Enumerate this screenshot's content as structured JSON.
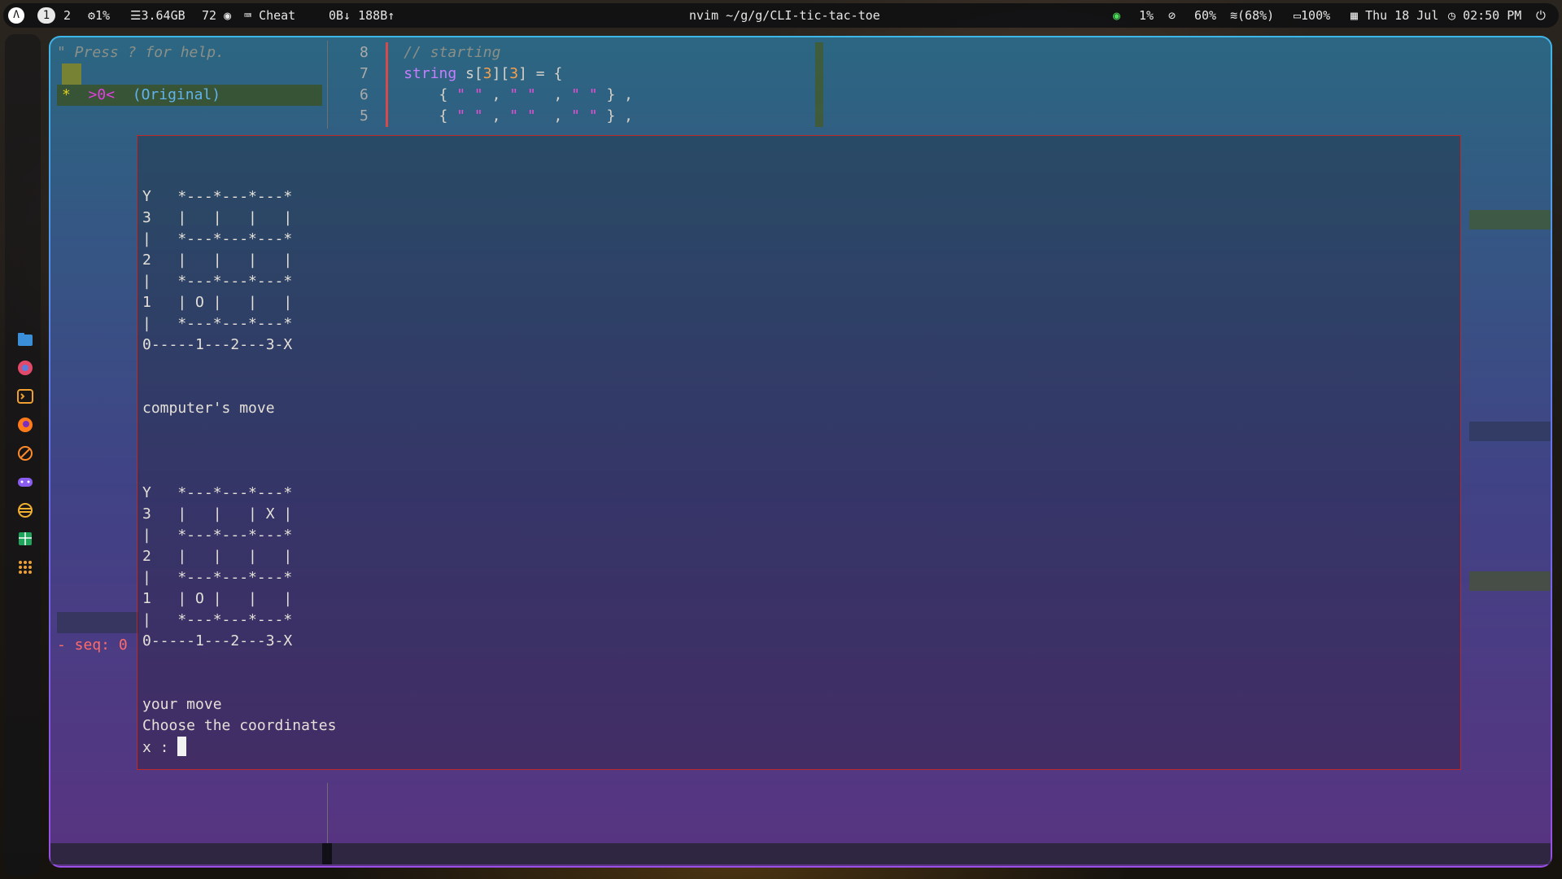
{
  "topbar": {
    "launcher_icon": "arch-logo-icon",
    "workspaces": [
      "1",
      "2"
    ],
    "active_workspace": "1",
    "cpu": "1%",
    "memory": "3.64GB",
    "temp": "72",
    "keyboard_app": "Cheat",
    "network_traffic": "0B↓ 188B↑",
    "window_title": "nvim ~/g/g/CLI-tic-tac-toe",
    "wifi_signal": "1%",
    "privacy_value": "60%",
    "wifi_strength": "(68%)",
    "battery": "100%",
    "date": "Thu 18 Jul",
    "time": "02:50 PM"
  },
  "dock": {
    "icons": [
      "file-manager-icon",
      "browser-icon",
      "terminal-icon",
      "firefox-icon",
      "tools-icon",
      "game-controller-icon",
      "settings-icon",
      "spreadsheet-icon",
      "app-grid-icon"
    ]
  },
  "nvim": {
    "help_hint": "\" Press ? for help.",
    "undotree_star": "*",
    "undotree_marker": ">0<",
    "undotree_label": "(Original)",
    "seq_label": "- seq: 0",
    "code_lines": [
      {
        "num": "8",
        "comment": "// starting"
      },
      {
        "num": "7",
        "kw": "string",
        "text": " s[",
        "n1": "3",
        "mid": "][",
        "n2": "3",
        "end": "] = {"
      },
      {
        "num": "6",
        "open": "    { ",
        "s1": "\" \"",
        "c1": " , ",
        "s2": "\" \"",
        "c2": "  , ",
        "s3": "\" \"",
        "close": " } ,"
      },
      {
        "num": "5",
        "open": "    { ",
        "s1": "\" \"",
        "c1": " , ",
        "s2": "\" \"",
        "c2": "  , ",
        "s3": "\" \"",
        "close": " } ,"
      }
    ]
  },
  "game": {
    "board1": "Y   *---*---*---*\n3   |   |   |   |\n|   *---*---*---*\n2   |   |   |   |\n|   *---*---*---*\n1   | O |   |   |\n|   *---*---*---*\n0-----1---2---3-X",
    "computer_msg": "computer's move",
    "board2": "Y   *---*---*---*\n3   |   |   | X |\n|   *---*---*---*\n2   |   |   |   |\n|   *---*---*---*\n1   | O |   |   |\n|   *---*---*---*\n0-----1---2---3-X",
    "your_move": "your move",
    "prompt": "Choose the coordinates",
    "input_label": "x : "
  },
  "colors": {
    "border_top": "#3fb6e8",
    "border_bottom": "#9a4fe6",
    "popup_border": "#c02828"
  }
}
